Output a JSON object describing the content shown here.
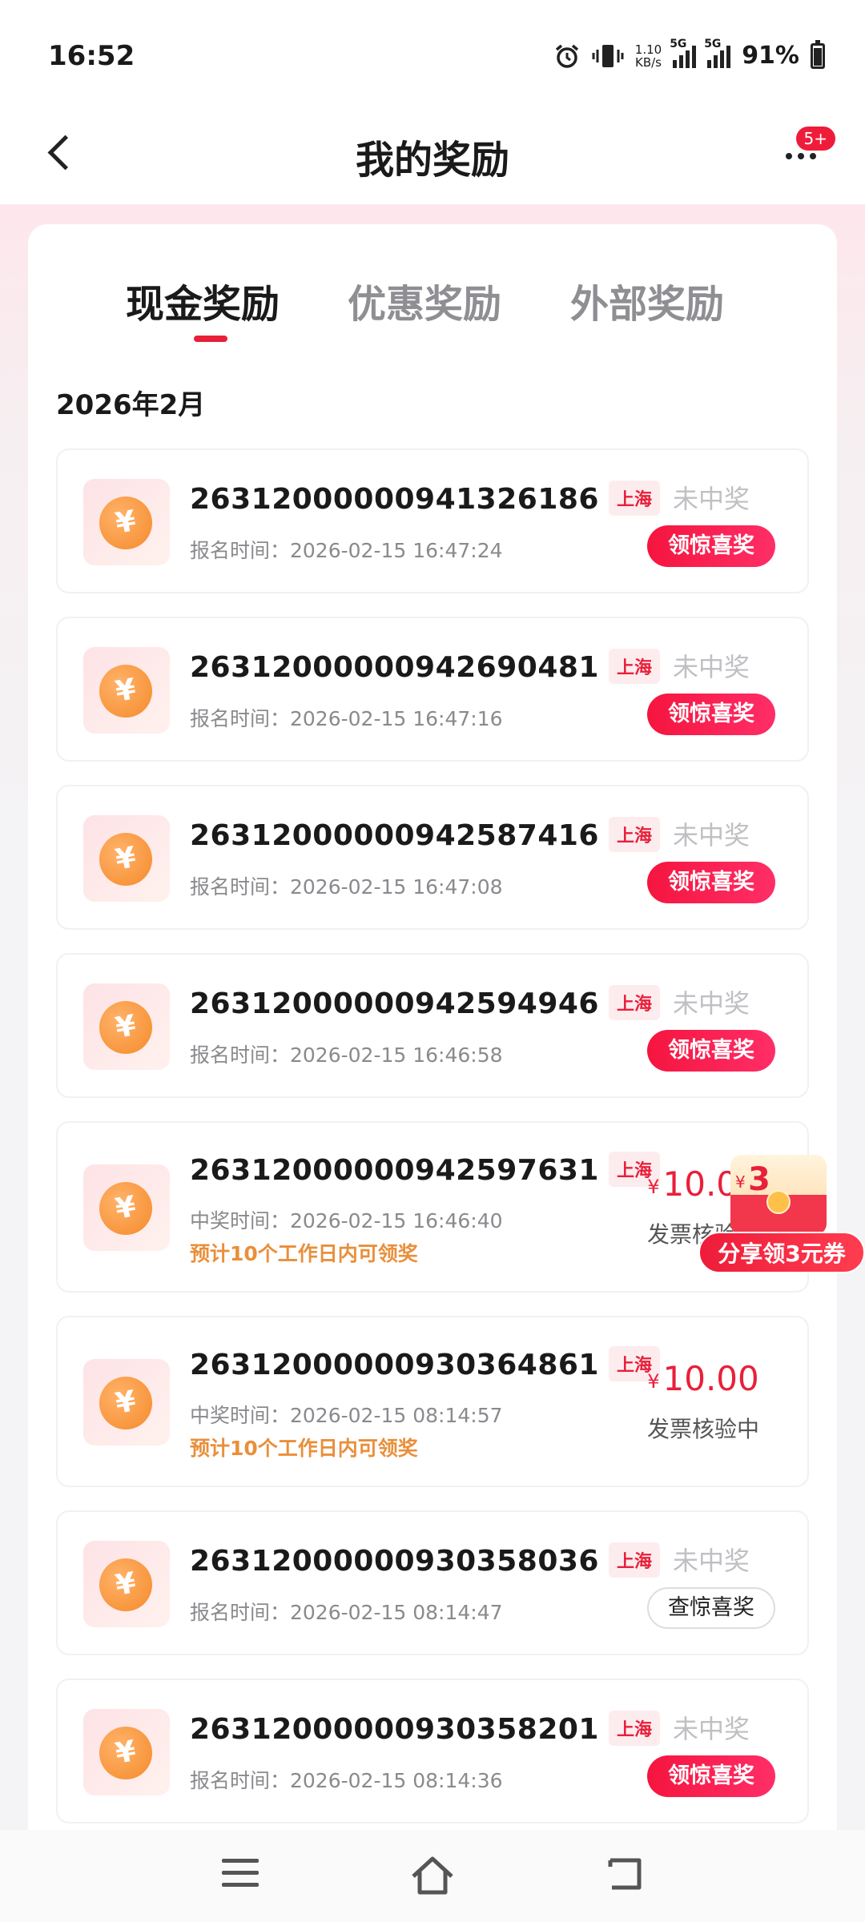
{
  "status_bar": {
    "time": "16:52",
    "net_speed_value": "1.10",
    "net_speed_unit": "KB/s",
    "signal1": "5G",
    "signal2": "5G",
    "battery": "91%"
  },
  "nav": {
    "title": "我的奖励",
    "badge": "5+"
  },
  "tabs": [
    {
      "label": "现金奖励",
      "active": true
    },
    {
      "label": "优惠奖励",
      "active": false
    },
    {
      "label": "外部奖励",
      "active": false
    }
  ],
  "month_header": "2026年2月",
  "items": [
    {
      "id": "26312000000941326186",
      "region": "上海",
      "time": "报名时间：2026-02-15 16:47:24",
      "status": "未中奖",
      "action": "领惊喜奖"
    },
    {
      "id": "26312000000942690481",
      "region": "上海",
      "time": "报名时间：2026-02-15 16:47:16",
      "status": "未中奖",
      "action": "领惊喜奖"
    },
    {
      "id": "26312000000942587416",
      "region": "上海",
      "time": "报名时间：2026-02-15 16:47:08",
      "status": "未中奖",
      "action": "领惊喜奖"
    },
    {
      "id": "26312000000942594946",
      "region": "上海",
      "time": "报名时间：2026-02-15 16:46:58",
      "status": "未中奖",
      "action": "领惊喜奖"
    },
    {
      "id": "26312000000942597631",
      "region": "上海",
      "time": "中奖时间：2026-02-15 16:46:40",
      "note": "预计10个工作日内可领奖",
      "amount_symbol": "¥",
      "amount": "10.00",
      "amount_status": "发票核验中"
    },
    {
      "id": "26312000000930364861",
      "region": "上海",
      "time": "中奖时间：2026-02-15 08:14:57",
      "note": "预计10个工作日内可领奖",
      "amount_symbol": "¥",
      "amount": "10.00",
      "amount_status": "发票核验中"
    },
    {
      "id": "26312000000930358036",
      "region": "上海",
      "time": "报名时间：2026-02-15 08:14:47",
      "status": "未中奖",
      "action": "查惊喜奖"
    },
    {
      "id": "26312000000930358201",
      "region": "上海",
      "time": "报名时间：2026-02-15 08:14:36",
      "status": "未中奖",
      "action": "领惊喜奖"
    }
  ],
  "coin_symbol": "¥",
  "promo": {
    "envelope_symbol": "¥",
    "envelope_value": "3",
    "label": "分享领3元券"
  },
  "colors": {
    "accent_red": "#e8203a",
    "note_orange": "#e98f3a",
    "muted_gray": "#c0c0c4"
  }
}
